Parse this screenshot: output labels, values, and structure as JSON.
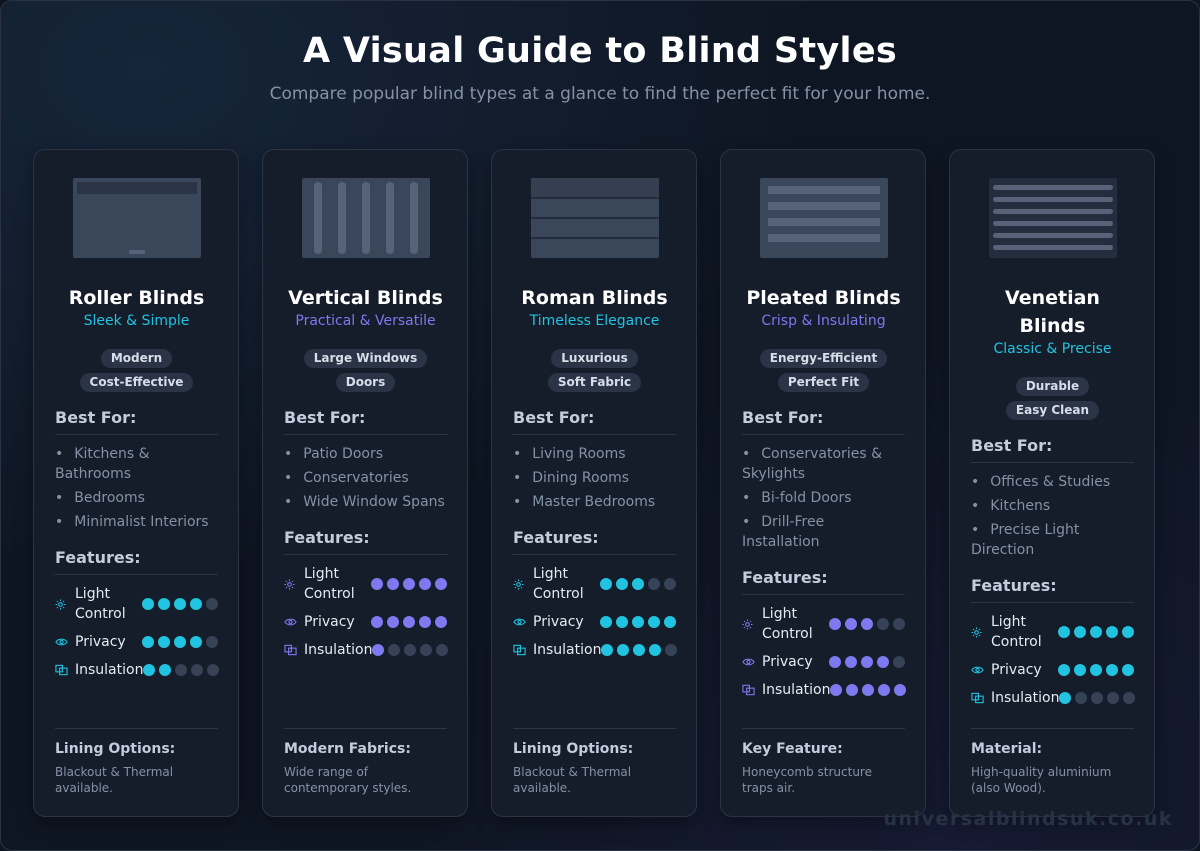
{
  "title": "A Visual Guide to Blind Styles",
  "subtitle": "Compare popular blind types at a glance to find the perfect fit for your home.",
  "labels": {
    "best_for": "Best For:",
    "features": "Features:"
  },
  "feature_labels": {
    "light": "Light Control",
    "privacy": "Privacy",
    "insulation": "Insulation"
  },
  "colors": {
    "cyan": "#22c3e0",
    "violet": "#7d79ef",
    "dot_off": "#364255"
  },
  "watermark": "universalblindsuk.co.uk",
  "cards": [
    {
      "title": "Roller Blinds",
      "tagline": "Sleek & Simple",
      "accent": "cyan",
      "badges": [
        "Modern",
        "Cost-Effective"
      ],
      "best_for": [
        "Kitchens & Bathrooms",
        "Bedrooms",
        "Minimalist Interiors"
      ],
      "features": {
        "light": 4,
        "privacy": 4,
        "insulation": 2
      },
      "bottom_title": "Lining Options:",
      "bottom_text": "Blackout & Thermal available."
    },
    {
      "title": "Vertical Blinds",
      "tagline": "Practical & Versatile",
      "accent": "violet",
      "badges": [
        "Large Windows",
        "Doors"
      ],
      "best_for": [
        "Patio Doors",
        "Conservatories",
        "Wide Window Spans"
      ],
      "features": {
        "light": 5,
        "privacy": 5,
        "insulation": 1
      },
      "bottom_title": "Modern Fabrics:",
      "bottom_text": "Wide range of contemporary styles."
    },
    {
      "title": "Roman Blinds",
      "tagline": "Timeless Elegance",
      "accent": "cyan",
      "badges": [
        "Luxurious",
        "Soft Fabric"
      ],
      "best_for": [
        "Living Rooms",
        "Dining Rooms",
        "Master Bedrooms"
      ],
      "features": {
        "light": 3,
        "privacy": 5,
        "insulation": 4
      },
      "bottom_title": "Lining Options:",
      "bottom_text": "Blackout & Thermal available."
    },
    {
      "title": "Pleated Blinds",
      "tagline": "Crisp & Insulating",
      "accent": "violet",
      "badges": [
        "Energy-Efficient",
        "Perfect Fit"
      ],
      "best_for": [
        "Conservatories & Skylights",
        "Bi-fold Doors",
        "Drill-Free Installation"
      ],
      "features": {
        "light": 3,
        "privacy": 4,
        "insulation": 5
      },
      "bottom_title": "Key Feature:",
      "bottom_text": "Honeycomb structure traps air."
    },
    {
      "title": "Venetian Blinds",
      "tagline": "Classic & Precise",
      "accent": "cyan",
      "badges": [
        "Durable",
        "Easy Clean"
      ],
      "best_for": [
        "Offices & Studies",
        "Kitchens",
        "Precise Light Direction"
      ],
      "features": {
        "light": 5,
        "privacy": 5,
        "insulation": 1
      },
      "bottom_title": "Material:",
      "bottom_text": "High-quality aluminium (also Wood)."
    }
  ]
}
